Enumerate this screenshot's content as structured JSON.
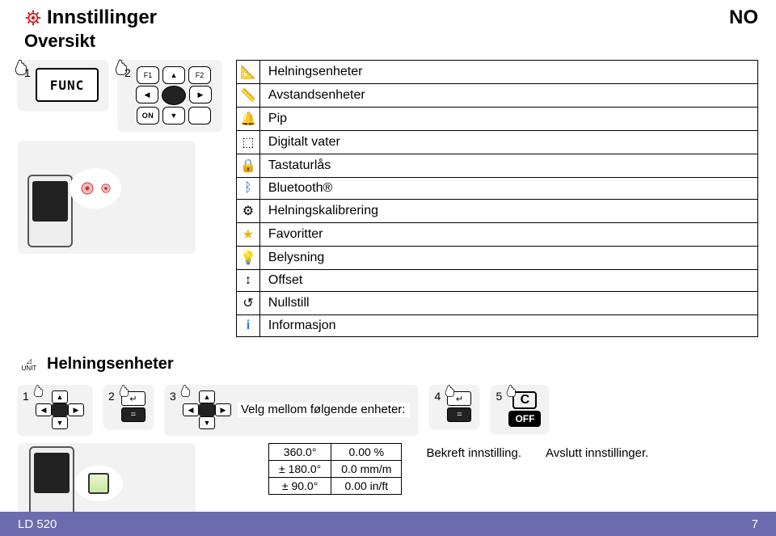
{
  "header": {
    "title": "Innstillinger",
    "subtitle": "Oversikt",
    "lang": "NO"
  },
  "steps_top": {
    "one": "1",
    "two": "2",
    "func_label": "FUNC",
    "on_label": "ON",
    "f1": "F1",
    "f2": "F2"
  },
  "menu": {
    "items": [
      {
        "label": "Helningsenheter"
      },
      {
        "label": "Avstandsenheter"
      },
      {
        "label": "Pip"
      },
      {
        "label": "Digitalt vater"
      },
      {
        "label": "Tastaturlås"
      },
      {
        "label": "Bluetooth®"
      },
      {
        "label": "Helningskalibrering"
      },
      {
        "label": "Favoritter"
      },
      {
        "label": "Belysning"
      },
      {
        "label": "Offset"
      },
      {
        "label": "Nullstill"
      },
      {
        "label": "Informasjon"
      }
    ]
  },
  "section2": {
    "unit_small": "UNIT",
    "title": "Helningsenheter"
  },
  "steps_bottom": {
    "one": "1",
    "two": "2",
    "three": "3",
    "four": "4",
    "five": "5",
    "select_text": "Velg mellom følgende enheter:",
    "confirm_text": "Bekreft innstilling.",
    "exit_text": "Avslutt innstillinger.",
    "c_label": "C",
    "off_label": "OFF"
  },
  "units": {
    "r1c1": "360.0°",
    "r1c2": "0.00 %",
    "r2c1": "± 180.0°",
    "r2c2": "0.0 mm/m",
    "r3c1": "± 90.0°",
    "r3c2": "0.00 in/ft"
  },
  "footer": {
    "model": "LD 520",
    "page": "7"
  }
}
